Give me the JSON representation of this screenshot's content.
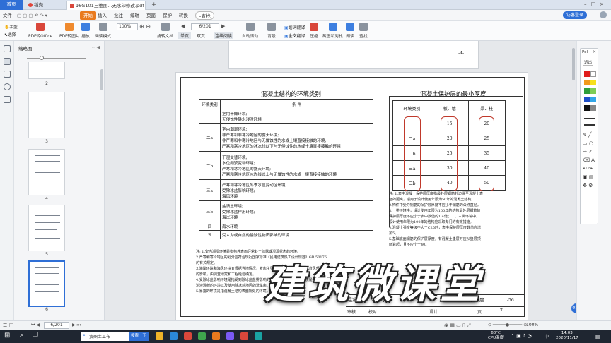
{
  "tabs": {
    "home": "首页",
    "daoke": "稻壳",
    "pdf": "16G101三维图...无水印修改.pdf",
    "add": "+"
  },
  "menu": {
    "file": "文件",
    "open": "开始",
    "insert": "插入",
    "annotate": "批注",
    "edit": "编辑",
    "page": "页面",
    "protect": "保护",
    "convert": "转换",
    "search": "查找",
    "login": "访客登录"
  },
  "toolbar": {
    "hand": "手型",
    "select": "选择",
    "pdf_office": "PDF转Office",
    "pdf_image": "PDF转图片",
    "play": "播放",
    "read_mode": "阅读模式",
    "zoom": "100%",
    "rotate": "旋转文档",
    "page_input": "6/201",
    "single": "单页",
    "double": "双页",
    "continuous": "连续阅读",
    "auto_scroll": "自动滚动",
    "background": "背景",
    "translate": "划词翻译",
    "full_translate": "全文翻译",
    "compress": "压缩",
    "screenshot": "截图和对比",
    "read": "朗读",
    "find": "查找"
  },
  "panel": {
    "title": "缩略图",
    "thumbs": [
      "2",
      "3",
      "4",
      "5",
      "6"
    ]
  },
  "doc": {
    "prev_page_num": "-4-",
    "left_title": "混凝土结构的环境类别",
    "left_headers": [
      "环境类别",
      "条  件"
    ],
    "left_rows": [
      [
        "一",
        "室内干燥环境;",
        "无侵蚀性静水浸没环境"
      ],
      [
        "二a",
        "室内潮湿环境;",
        "非严寒和非寒冷地区的露天环境;",
        "非严寒和非寒冷地区与无侵蚀性的水或土壤直接接触的环境;",
        "严寒和寒冷地区的冰冻线以下与无侵蚀性的水或土壤直接接触的环境"
      ],
      [
        "二b",
        "干湿交替环境;",
        "水位频繁变动环境;",
        "严寒和寒冷地区的露天环境;",
        "严寒和寒冷地区冰冻线以上与无侵蚀性的水或土壤直接接触的环境"
      ],
      [
        "三a",
        "严寒和寒冷地区冬季水位变动区环境;",
        "受除冰盐影响环境;",
        "海风环境"
      ],
      [
        "三b",
        "盐渍土环境;",
        "受除冰盐作用环境;",
        "海岸环境"
      ],
      [
        "四",
        "海水环境"
      ],
      [
        "五",
        "受人为或自然的侵蚀性物质影响的环境"
      ]
    ],
    "left_notes": [
      "注: 1.室内潮湿环境是指构件表面经常处于结露或湿润状态的环境。",
      "2.严寒和寒冷地区的划分应符合现行国家标准《民用建筑热工设计规范》GB 50176",
      "的有关规定。",
      "3.海岸环境和海风环境宜根据当地情况，考虑主导风向及结构所处迎风、背风部位等因素",
      "的影响，由调查研究和工程经验确定。",
      "4.受除冰盐影响环境是指受到除冰盐盐雾影响的环境；受除冰盐作用环境是指被除冰盐",
      "溶液溅射的环境以及使用除冰盐地区的洗车房、停车楼等建筑。",
      "5.暴露的环境是指混凝土结构表面所处的环境。"
    ],
    "right_title": "混凝土保护层的最小厚度",
    "right_headers": [
      "环境类别",
      "板、墙",
      "梁、柱"
    ],
    "right_rows": [
      [
        "一",
        "15",
        "20"
      ],
      [
        "二a",
        "20",
        "25"
      ],
      [
        "二b",
        "25",
        "35"
      ],
      [
        "三a",
        "30",
        "40"
      ],
      [
        "三b",
        "40",
        "50"
      ]
    ],
    "right_notes": [
      "注: 1.表中混凝土保护层厚度指最外层钢筋外边缘至混凝土表",
      "面的距离，适用于设计使用年限为50年的混凝土结构。",
      "2.构件中受力钢筋的保护层厚度不应小于钢筋的公称直径。",
      "3.一类环境中，设计使用年限为100年的结构最外层钢筋的",
      "保护层厚度不应小于表中数值的1.4倍；二、三类环境中，",
      "设计使用年限为100年的结构应采取专门的有效措施。",
      "4.混凝土强度等级不大于C25时，表中保护层厚度数值应增",
      "加5。",
      "5.基础底面钢筋的保护层厚度，有混凝土垫层时应从垫层顶",
      "面算起，且不应小于40。"
    ],
    "footer": {
      "title_a": "混凝",
      "title_b": "的",
      "title_c": "最小厚度",
      "atlas": "-56",
      "review": "审核",
      "check": "校对",
      "design": "设计",
      "page_label": "页",
      "page_num": "-7-"
    }
  },
  "watermark": "建筑微课堂",
  "time_badge": "01:07",
  "pen": {
    "title": "Pol",
    "close": "×",
    "transparent": "透出"
  },
  "status": {
    "page_input": "6/201",
    "zoom": "100%"
  },
  "taskbar": {
    "task": "贵州土工布",
    "search_btn": "搜索一下",
    "weather": "60°C",
    "cpu": "CPU温度",
    "time": "14:03",
    "date": "2020/11/17",
    "lang": "中"
  },
  "colors": {
    "accent": "#2f6fd6",
    "open": "#e97a1e",
    "annotation": "#c0392b"
  }
}
